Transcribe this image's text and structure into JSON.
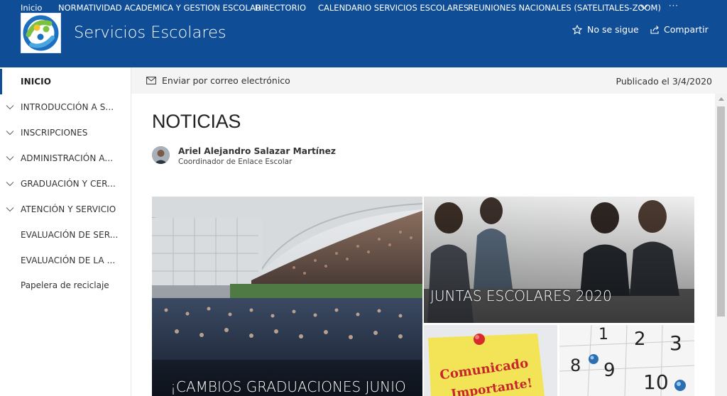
{
  "top_nav": {
    "items": [
      {
        "label": "Inicio"
      },
      {
        "label": "NORMATIVIDAD ACADEMICA Y GESTION ESCOLAR"
      },
      {
        "label": "DIRECTORIO"
      },
      {
        "label": "CALENDARIO SERVICIOS ESCOLARES"
      },
      {
        "label": "REUNIONES NACIONALES (SATELITALES-ZOOM)"
      }
    ],
    "more_label": "···"
  },
  "site": {
    "title": "Servicios Escolares"
  },
  "actions": {
    "follow_label": "No se sigue",
    "share_label": "Compartir"
  },
  "left_nav": {
    "items": [
      {
        "label": "INICIO",
        "active": true,
        "expandable": false
      },
      {
        "label": "INTRODUCCIÓN A S...",
        "expandable": true
      },
      {
        "label": "INSCRIPCIONES",
        "expandable": true
      },
      {
        "label": "ADMINISTRACIÓN A...",
        "expandable": true
      },
      {
        "label": "GRADUACIÓN Y CER...",
        "expandable": true
      },
      {
        "label": "ATENCIÓN Y SERVICIO",
        "expandable": true
      },
      {
        "label": "EVALUACIÓN DE SER...",
        "expandable": false
      },
      {
        "label": "EVALUACIÓN DE LA ...",
        "expandable": false
      },
      {
        "label": "Papelera de reciclaje",
        "expandable": false
      }
    ]
  },
  "command_bar": {
    "email_label": "Enviar por correo electrónico",
    "published_label": "Publicado el 3/4/2020"
  },
  "page": {
    "title": "NOTICIAS",
    "author": {
      "name": "Ariel Alejandro Salazar Martínez",
      "role": "Coordinador de Enlace Escolar"
    }
  },
  "news": {
    "tiles": [
      {
        "caption": "¡CAMBIOS GRADUACIONES JUNIO"
      },
      {
        "caption": "JUNTAS ESCOLARES 2020"
      },
      {
        "caption": "",
        "note_text_1": "Comunicado",
        "note_text_2": "Importante!"
      },
      {
        "caption": ""
      }
    ]
  },
  "colors": {
    "brand": "#0f4d97",
    "command_bar_bg": "#f4f4f4"
  }
}
